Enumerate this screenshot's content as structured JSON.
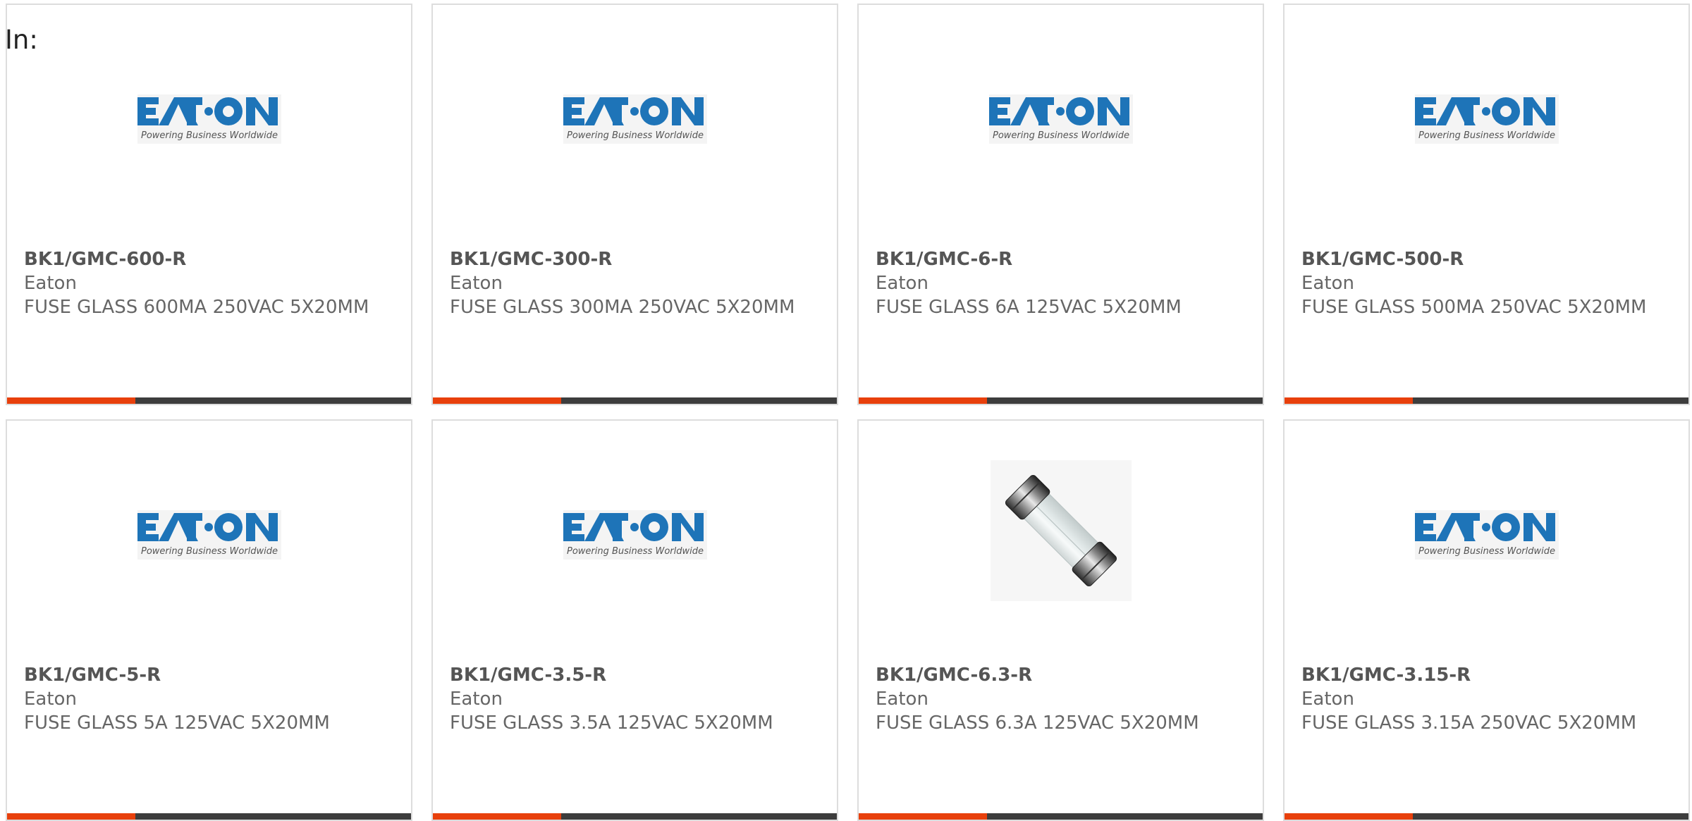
{
  "filter": {
    "label": "In:"
  },
  "colors": {
    "eaton_blue": "#1e74b8",
    "card_border": "#dddddd",
    "text": "#666666",
    "bar_dark": "#3d3d3d",
    "bar_accent": "#e8400c"
  },
  "products": [
    {
      "part_number": "BK1/GMC-600-R",
      "manufacturer": "Eaton",
      "description": "FUSE GLASS 600MA 250VAC 5X20MM",
      "image": "eaton-logo"
    },
    {
      "part_number": "BK1/GMC-300-R",
      "manufacturer": "Eaton",
      "description": "FUSE GLASS 300MA 250VAC 5X20MM",
      "image": "eaton-logo"
    },
    {
      "part_number": "BK1/GMC-6-R",
      "manufacturer": "Eaton",
      "description": "FUSE GLASS 6A 125VAC 5X20MM",
      "image": "eaton-logo"
    },
    {
      "part_number": "BK1/GMC-500-R",
      "manufacturer": "Eaton",
      "description": "FUSE GLASS 500MA 250VAC 5X20MM",
      "image": "eaton-logo"
    },
    {
      "part_number": "BK1/GMC-5-R",
      "manufacturer": "Eaton",
      "description": "FUSE GLASS 5A 125VAC 5X20MM",
      "image": "eaton-logo"
    },
    {
      "part_number": "BK1/GMC-3.5-R",
      "manufacturer": "Eaton",
      "description": "FUSE GLASS 3.5A 125VAC 5X20MM",
      "image": "eaton-logo"
    },
    {
      "part_number": "BK1/GMC-6.3-R",
      "manufacturer": "Eaton",
      "description": "FUSE GLASS 6.3A 125VAC 5X20MM",
      "image": "fuse-photo"
    },
    {
      "part_number": "BK1/GMC-3.15-R",
      "manufacturer": "Eaton",
      "description": "FUSE GLASS 3.15A 250VAC 5X20MM",
      "image": "eaton-logo"
    }
  ],
  "logo": {
    "wordmark": "EATON",
    "tagline": "Powering Business Worldwide"
  }
}
